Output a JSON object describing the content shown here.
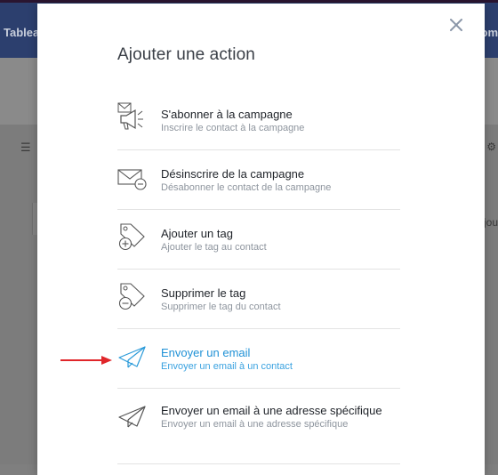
{
  "background": {
    "header_left": "Tablea",
    "header_right": "om",
    "right_fragment": "ajou"
  },
  "modal": {
    "title": "Ajouter une action",
    "close_icon": "close-icon",
    "items": [
      {
        "title": "S'abonner à la campagne",
        "subtitle": "Inscrire le contact à la campagne",
        "icon": "megaphone-icon"
      },
      {
        "title": "Désinscrire de la campagne",
        "subtitle": "Désabonner le contact de la campagne",
        "icon": "envelope-minus-icon"
      },
      {
        "title": "Ajouter un tag",
        "subtitle": "Ajouter le tag au contact",
        "icon": "tag-plus-icon"
      },
      {
        "title": "Supprimer le tag",
        "subtitle": "Supprimer le tag du contact",
        "icon": "tag-minus-icon"
      },
      {
        "title": "Envoyer un email",
        "subtitle": "Envoyer un email à un contact",
        "icon": "paper-plane-icon",
        "active": true
      },
      {
        "title": "Envoyer un email à une adresse spécifique",
        "subtitle": "Envoyer un email à une adresse spécifique",
        "icon": "paper-plane-icon"
      }
    ]
  },
  "colors": {
    "accent": "#1f91d6",
    "arrow": "#e0262a"
  }
}
